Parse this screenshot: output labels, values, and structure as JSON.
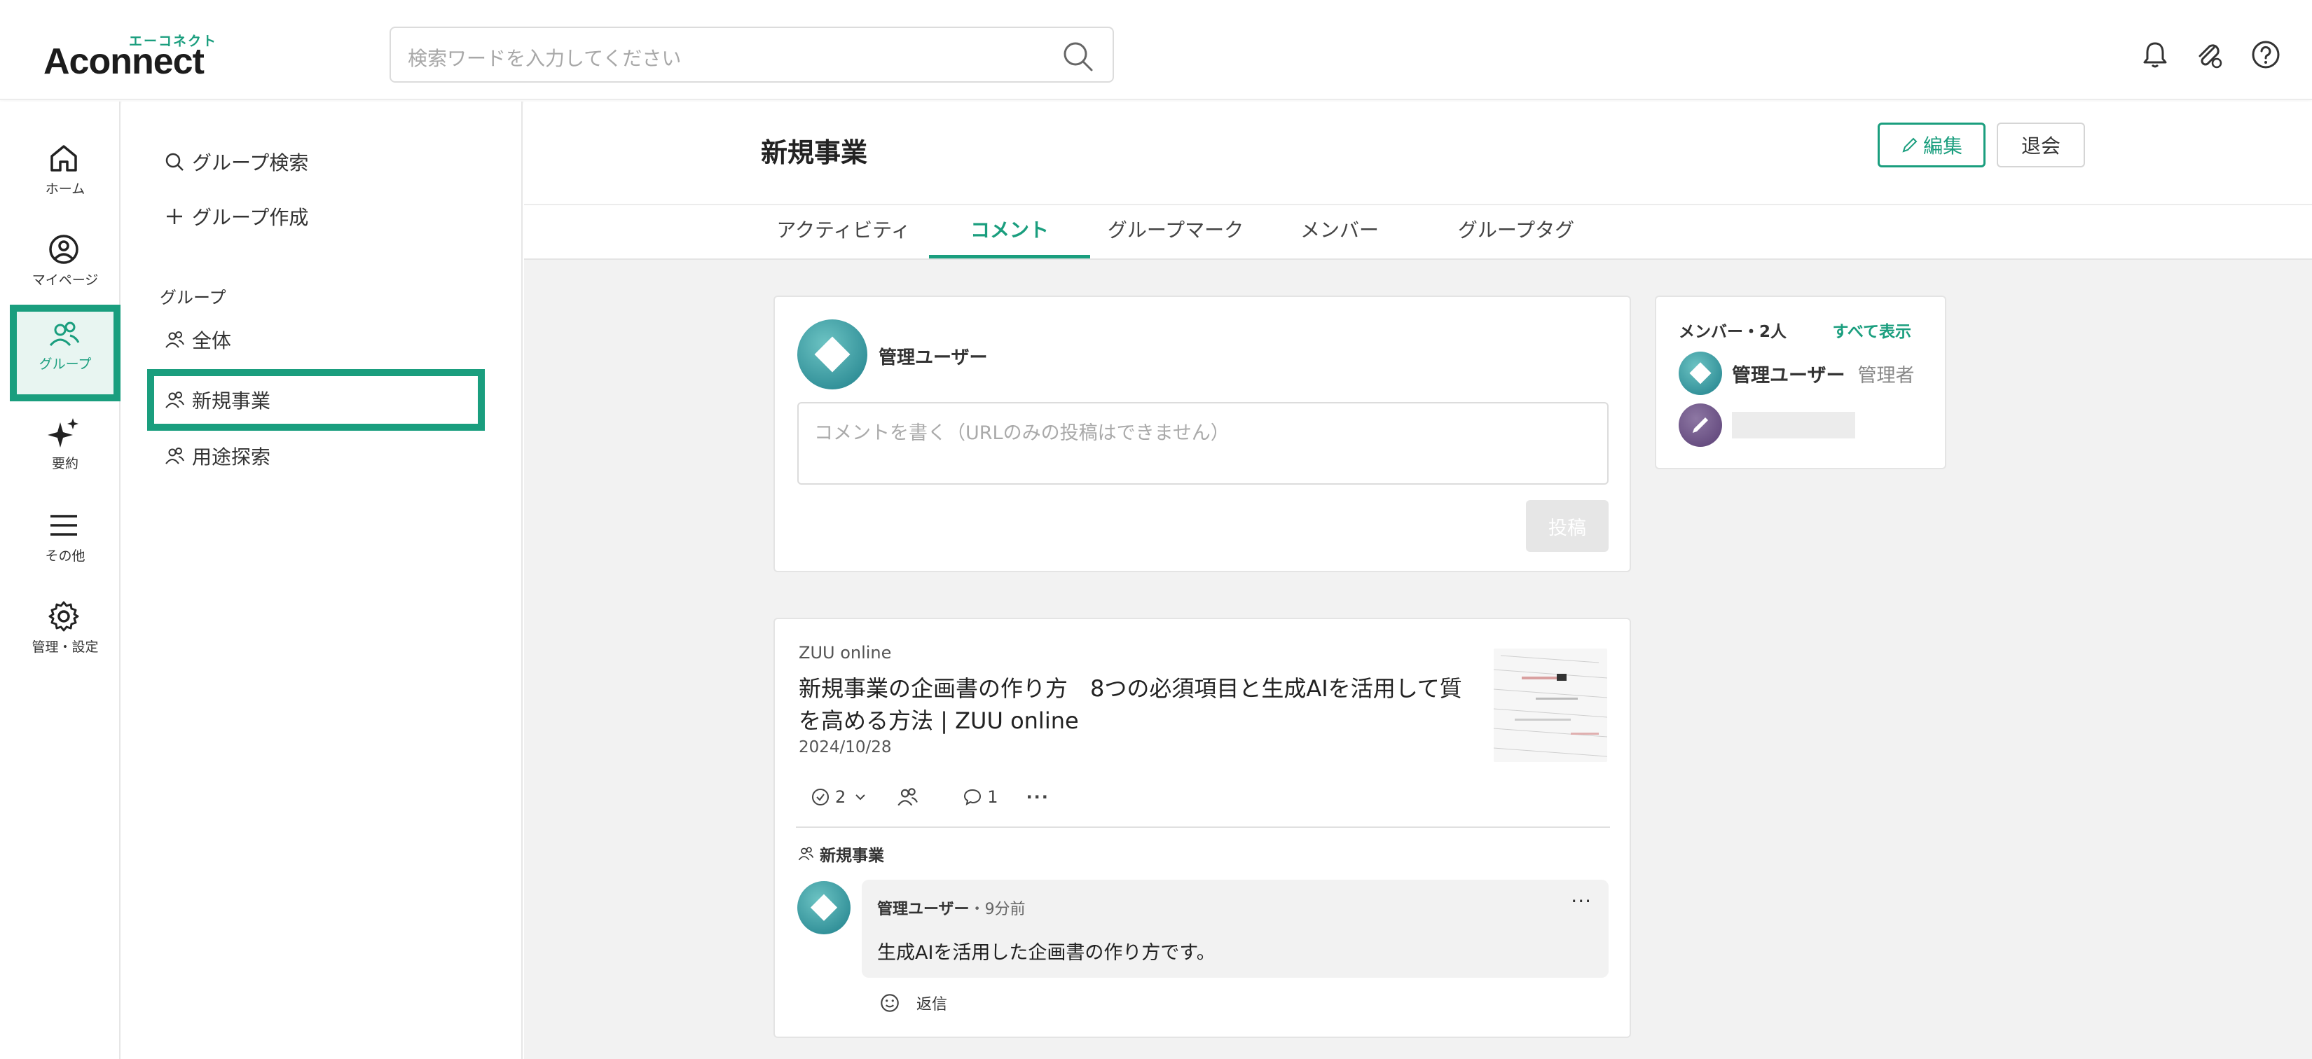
{
  "brand": {
    "name": "Aconnect",
    "kana": "エーコネクト",
    "accent_color": "#1a9e7e"
  },
  "search": {
    "placeholder": "検索ワードを入力してください",
    "icon": "search-icon"
  },
  "header_icons": [
    "bell-icon",
    "paperclip-icon",
    "help-icon"
  ],
  "rail": {
    "items": [
      {
        "label": "ホーム",
        "icon": "home-icon"
      },
      {
        "label": "マイページ",
        "icon": "user-circle-icon"
      },
      {
        "label": "グループ",
        "icon": "group-icon",
        "active": true
      },
      {
        "label": "要約",
        "icon": "sparkle-icon"
      },
      {
        "label": "その他",
        "icon": "menu-icon"
      },
      {
        "label": "管理・設定",
        "icon": "gear-icon"
      }
    ]
  },
  "group_panel": {
    "search_label": "グループ検索",
    "create_label": "グループ作成",
    "heading": "グループ",
    "groups": [
      {
        "label": "全体"
      },
      {
        "label": "新規事業",
        "selected": true
      },
      {
        "label": "用途探索"
      }
    ]
  },
  "page": {
    "title": "新規事業",
    "edit_label": "編集",
    "leave_label": "退会",
    "tabs": [
      {
        "label": "アクティビティ"
      },
      {
        "label": "コメント",
        "active": true
      },
      {
        "label": "グループマーク"
      },
      {
        "label": "メンバー"
      },
      {
        "label": "グループタグ"
      }
    ]
  },
  "composer": {
    "user": "管理ユーザー",
    "placeholder": "コメントを書く（URLのみの投稿はできません）",
    "post_label": "投稿"
  },
  "article": {
    "source": "ZUU online",
    "title": "新規事業の企画書の作り方　8つの必須項目と生成AIを活用して質を高める方法 | ZUU online",
    "date": "2024/10/28",
    "check_count": "2",
    "comment_count": "1",
    "more": "···",
    "group": "新規事業",
    "comment": {
      "author": "管理ユーザー",
      "time": "・9分前",
      "text": "生成AIを活用した企画書の作り方です。",
      "more": "···",
      "reply_label": "返信"
    }
  },
  "members": {
    "heading": "メンバー・2人",
    "show_all": "すべて表示",
    "list": [
      {
        "name": "管理ユーザー",
        "role": "管理者"
      },
      {
        "name": "",
        "role": ""
      }
    ]
  }
}
